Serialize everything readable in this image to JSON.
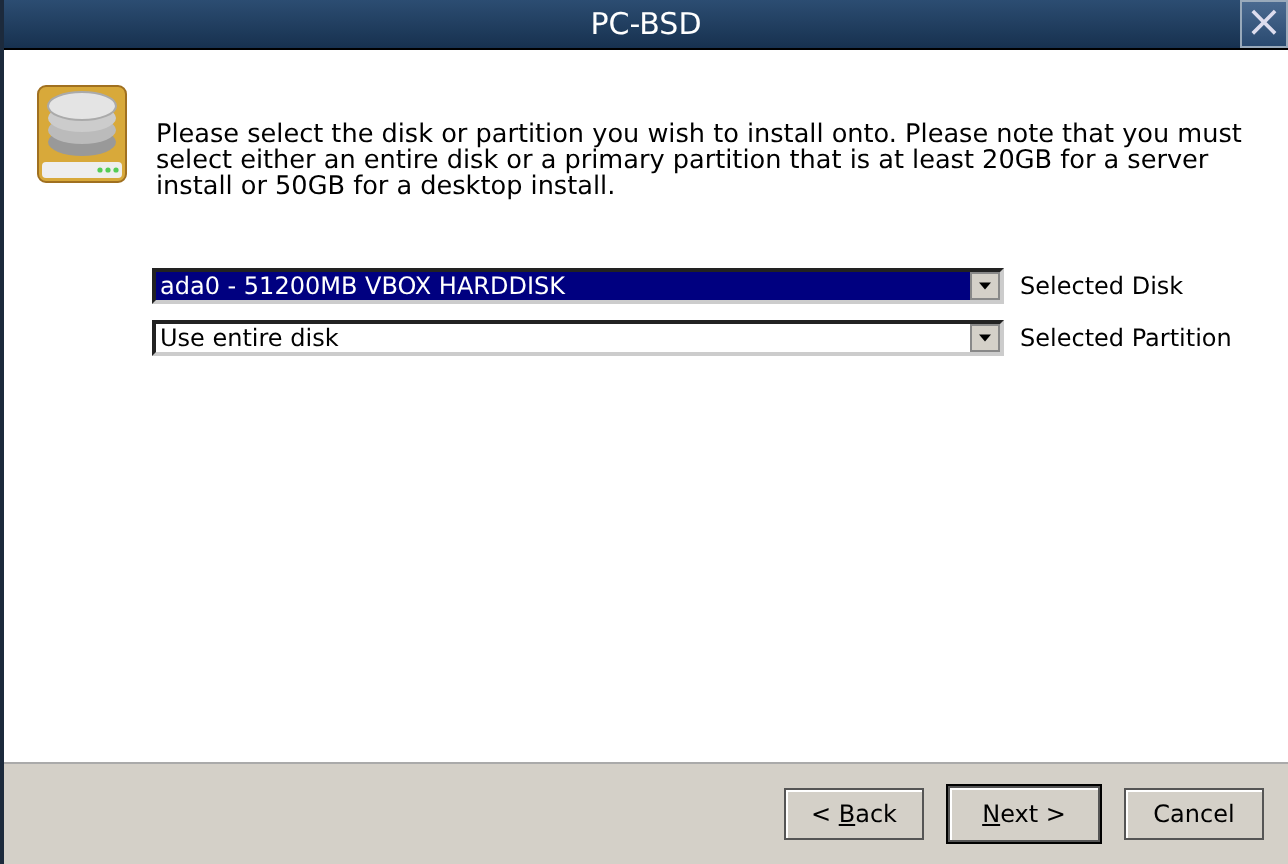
{
  "window": {
    "title": "PC-BSD",
    "close": "×"
  },
  "intro": "Please select the disk or partition you wish to install onto. Please note that you must select either an entire disk or a primary partition that is at least 20GB for a server install or 50GB for a desktop install.",
  "fields": [
    {
      "value": "ada0 - 51200MB VBOX HARDDISK",
      "label": "Selected Disk",
      "focused": true
    },
    {
      "value": "Use entire disk",
      "label": "Selected Partition",
      "focused": false
    }
  ],
  "buttons": [
    {
      "before": "< ",
      "key": "B",
      "after": "ack",
      "default": false
    },
    {
      "key": "N",
      "after": "ext >",
      "default": true
    },
    {
      "before": "Cancel",
      "default": false
    }
  ]
}
